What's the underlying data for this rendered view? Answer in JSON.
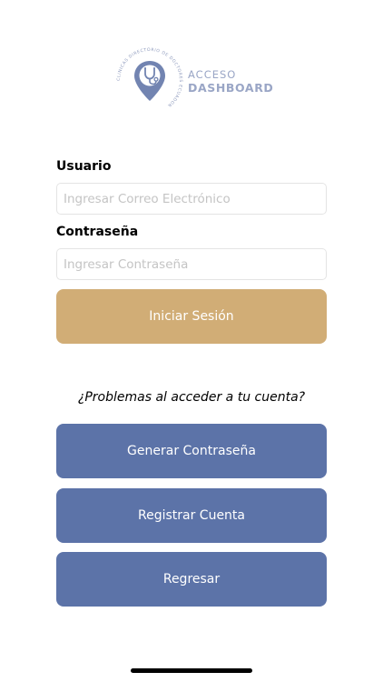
{
  "logo": {
    "ring_text": "CLINICAS DIRECTORIO DE DOCTORES ECUADOR",
    "line1": "ACCESO",
    "line2": "DASHBOARD",
    "color": "#9aa6c6"
  },
  "form": {
    "user_label": "Usuario",
    "user_placeholder": "Ingresar Correo Electrónico",
    "user_value": "",
    "password_label": "Contraseña",
    "password_placeholder": "Ingresar Contraseña",
    "password_value": "",
    "login_button": "Iniciar Sesión"
  },
  "help": {
    "question": "¿Problemas al acceder a tu cuenta?",
    "generate_button": "Generar Contraseña",
    "register_button": "Registrar Cuenta",
    "back_button": "Regresar"
  },
  "colors": {
    "primary_gold": "#d1ad76",
    "secondary_blue": "#5c73a8",
    "input_border": "#e4e4e4",
    "placeholder": "#c4c4c4"
  }
}
